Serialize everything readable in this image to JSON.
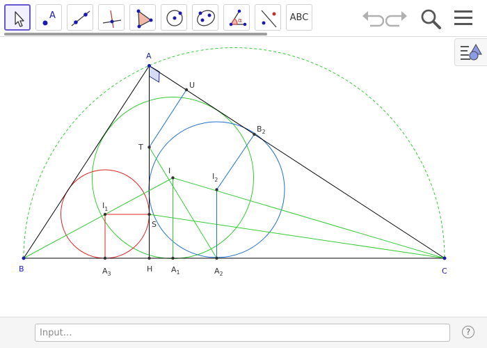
{
  "toolbar": {
    "tools": [
      {
        "name": "move-tool-icon",
        "selected": true
      },
      {
        "name": "point-tool-icon",
        "label": "A"
      },
      {
        "name": "line-tool-icon"
      },
      {
        "name": "perpendicular-line-tool-icon"
      },
      {
        "name": "polygon-tool-icon"
      },
      {
        "name": "circle-center-point-tool-icon"
      },
      {
        "name": "conic-tool-icon"
      },
      {
        "name": "angle-tool-icon",
        "label": "α"
      },
      {
        "name": "reflect-tool-icon"
      },
      {
        "name": "text-tool-icon",
        "label": "ABC"
      }
    ],
    "undo_icon": "undo-icon",
    "redo_icon": "redo-icon",
    "search_icon": "search-icon",
    "menu_icon": "hamburger-menu-icon"
  },
  "style_bar_icon": "style-bar-toggle-icon",
  "input_bar": {
    "placeholder": "Input…",
    "help_label": "?"
  },
  "points": {
    "A": {
      "label": "A"
    },
    "B": {
      "label": "B"
    },
    "C": {
      "label": "C"
    },
    "U": {
      "label": "U"
    },
    "B2": {
      "label": "B",
      "sub": "2"
    },
    "T": {
      "label": "T"
    },
    "I": {
      "label": "I"
    },
    "I2": {
      "label": "I",
      "sub": "2"
    },
    "I1": {
      "label": "I",
      "sub": "1"
    },
    "S": {
      "label": "S"
    },
    "A3": {
      "label": "A",
      "sub": "3"
    },
    "H": {
      "label": "H"
    },
    "A1": {
      "label": "A",
      "sub": "1"
    },
    "A2": {
      "label": "A",
      "sub": "2"
    }
  },
  "colors": {
    "selected_tool": "#6557d2",
    "triangle": "#000000",
    "green": "#33cc33",
    "blue": "#1e6fd0",
    "red": "#e02020",
    "label_blue": "#1a1ab0"
  }
}
